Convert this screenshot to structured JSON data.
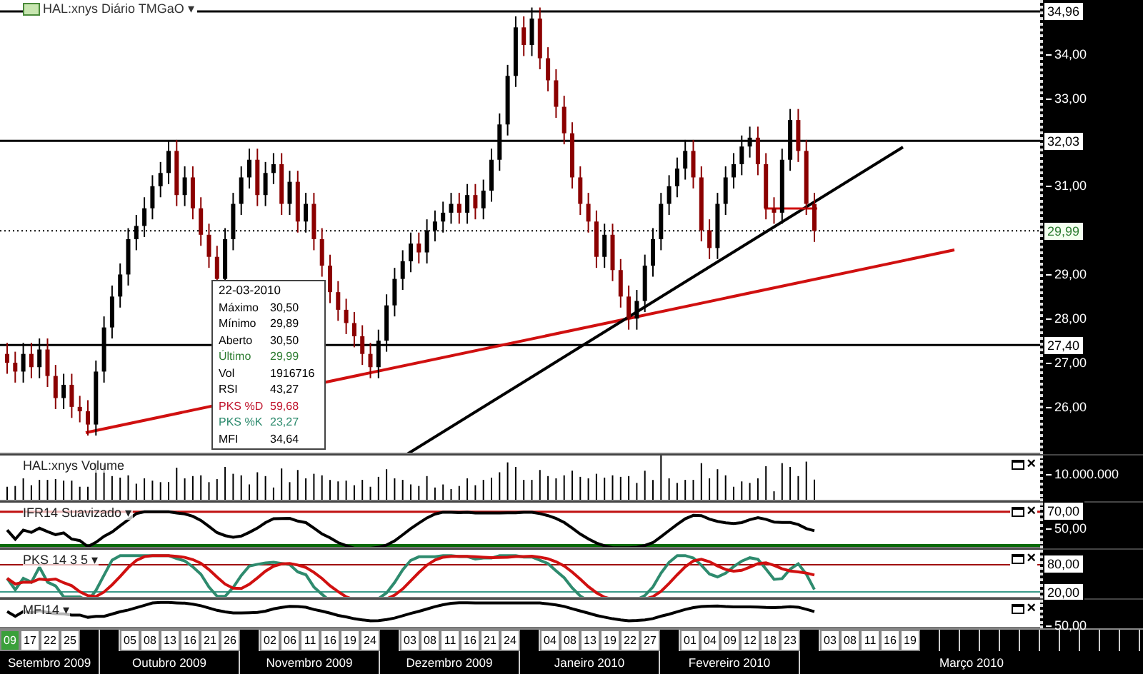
{
  "header": {
    "title": "HAL:xnys Diário TMGaO",
    "caret": "▾"
  },
  "price_chart": {
    "axis_labels": [
      "34,00",
      "33,00",
      "31,00",
      "29,00",
      "28,00",
      "27,00",
      "26,00"
    ],
    "price_tags": [
      {
        "kind": "level",
        "label": "34,96"
      },
      {
        "kind": "level",
        "label": "32,03"
      },
      {
        "kind": "last",
        "label": "29,99"
      },
      {
        "kind": "level",
        "label": "27,40"
      }
    ]
  },
  "tooltip": {
    "date": "22-03-2010",
    "rows": [
      {
        "label": "Máximo",
        "value": "30,50",
        "color": "#000000"
      },
      {
        "label": "Mínimo",
        "value": "29,89",
        "color": "#000000"
      },
      {
        "label": "Aberto",
        "value": "30,50",
        "color": "#000000"
      },
      {
        "label": "Último",
        "value": "29,99",
        "color": "#2e7d32"
      },
      {
        "label": "Vol",
        "value": "1916716",
        "color": "#000000"
      },
      {
        "label": "RSI",
        "value": "43,27",
        "color": "#000000"
      },
      {
        "label": "PKS %D",
        "value": "59,68",
        "color": "#c0142c"
      },
      {
        "label": "PKS %K",
        "value": "23,27",
        "color": "#2e8b6e"
      },
      {
        "label": "MFI",
        "value": "34,64",
        "color": "#000000"
      }
    ]
  },
  "panels": [
    {
      "kind": "volume",
      "title": "HAL:xnys Volume",
      "close_glyph": "×",
      "axis_labels": [
        {
          "text": "10.000.000",
          "tag": false
        }
      ]
    },
    {
      "kind": "rsi",
      "title": "IFR14 Suavizado",
      "caret": "▾",
      "close_glyph": "×",
      "axis_labels": [
        {
          "text": "70,00",
          "tag": true
        },
        {
          "text": "50,00",
          "tag": false
        }
      ]
    },
    {
      "kind": "stochastic",
      "title": "PKS 14 3 5",
      "caret": "▾",
      "close_glyph": "×",
      "axis_labels": [
        {
          "text": "80,00",
          "tag": true
        },
        {
          "text": "20,00",
          "tag": true
        }
      ]
    },
    {
      "kind": "mfi",
      "title": "MFI14",
      "caret": "▾",
      "close_glyph": "×",
      "axis_labels": [
        {
          "text": "50,00",
          "tag": false
        }
      ]
    }
  ],
  "time_axis": {
    "months": [
      {
        "label": "Setembro 2009",
        "days": [
          {
            "label": "09",
            "selected": true
          },
          {
            "label": "17",
            "selected": false
          },
          {
            "label": "22",
            "selected": false
          },
          {
            "label": "25",
            "selected": false
          }
        ]
      },
      {
        "label": "Outubro 2009",
        "days": [
          {
            "label": "05",
            "selected": false
          },
          {
            "label": "08",
            "selected": false
          },
          {
            "label": "13",
            "selected": false
          },
          {
            "label": "16",
            "selected": false
          },
          {
            "label": "21",
            "selected": false
          },
          {
            "label": "26",
            "selected": false
          }
        ]
      },
      {
        "label": "Novembro 2009",
        "days": [
          {
            "label": "02",
            "selected": false
          },
          {
            "label": "06",
            "selected": false
          },
          {
            "label": "11",
            "selected": false
          },
          {
            "label": "16",
            "selected": false
          },
          {
            "label": "19",
            "selected": false
          },
          {
            "label": "24",
            "selected": false
          }
        ]
      },
      {
        "label": "Dezembro 2009",
        "days": [
          {
            "label": "03",
            "selected": false
          },
          {
            "label": "08",
            "selected": false
          },
          {
            "label": "11",
            "selected": false
          },
          {
            "label": "16",
            "selected": false
          },
          {
            "label": "21",
            "selected": false
          },
          {
            "label": "24",
            "selected": false
          }
        ]
      },
      {
        "label": "Janeiro 2010",
        "days": [
          {
            "label": "04",
            "selected": false
          },
          {
            "label": "08",
            "selected": false
          },
          {
            "label": "13",
            "selected": false
          },
          {
            "label": "19",
            "selected": false
          },
          {
            "label": "22",
            "selected": false
          },
          {
            "label": "27",
            "selected": false
          }
        ]
      },
      {
        "label": "Fevereiro 2010",
        "days": [
          {
            "label": "01",
            "selected": false
          },
          {
            "label": "04",
            "selected": false
          },
          {
            "label": "09",
            "selected": false
          },
          {
            "label": "12",
            "selected": false
          },
          {
            "label": "18",
            "selected": false
          },
          {
            "label": "23",
            "selected": false
          }
        ]
      },
      {
        "label": "Março 2010",
        "days": [
          {
            "label": "03",
            "selected": false
          },
          {
            "label": "08",
            "selected": false
          },
          {
            "label": "11",
            "selected": false
          },
          {
            "label": "16",
            "selected": false
          },
          {
            "label": "19",
            "selected": false
          }
        ]
      }
    ]
  }
}
